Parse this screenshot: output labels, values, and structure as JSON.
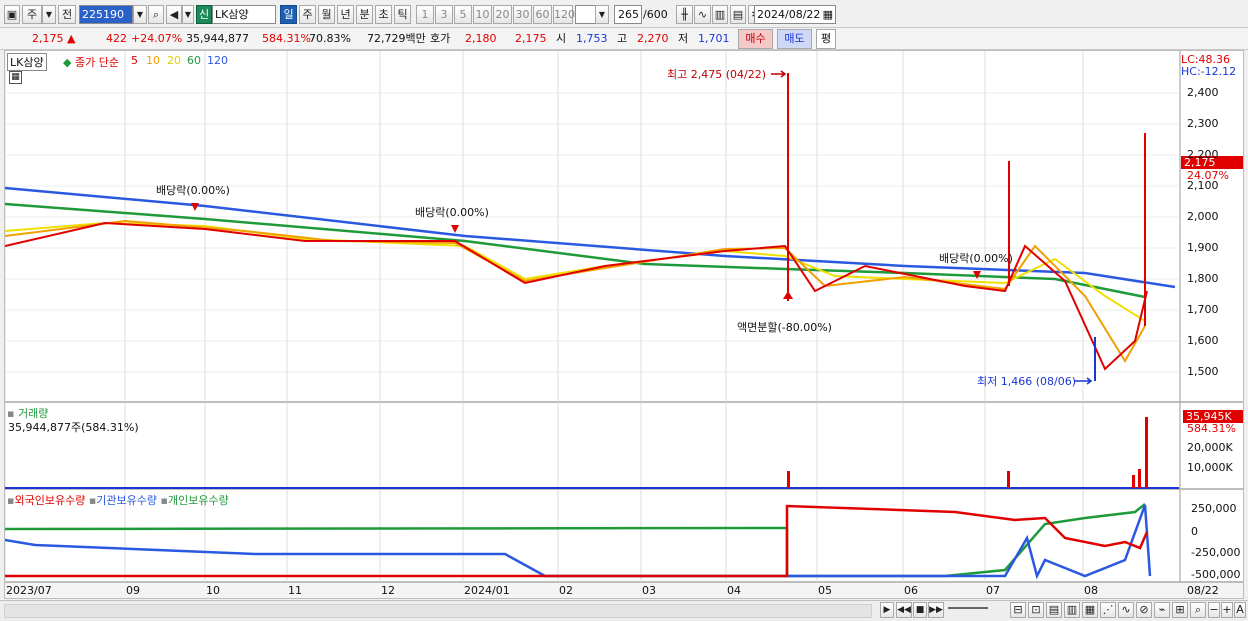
{
  "toolbar": {
    "period_label": "주",
    "prev_label": "전",
    "code": "225190",
    "sin_label": "신",
    "name": "LK삼양",
    "period_buttons": [
      "일",
      "주",
      "월",
      "년",
      "분",
      "초",
      "틱"
    ],
    "interval_buttons": [
      "1",
      "3",
      "5",
      "10",
      "20",
      "30",
      "60",
      "120"
    ],
    "count": "265",
    "count_total": "/600",
    "date": "2024/08/22"
  },
  "quote": {
    "price": "2,175",
    "change_arrow": "▲",
    "change": "422",
    "change_pct": "+24.07%",
    "volume": "35,944,877",
    "volume_ratio": "584.31%",
    "turnover": "70.83%",
    "amount": "72,729백만",
    "hoga_label": "호가",
    "ask": "2,180",
    "bid": "2,175",
    "open_label": "시",
    "open": "1,753",
    "high_label": "고",
    "high": "2,270",
    "low_label": "저",
    "low": "1,701",
    "buy_label": "매수",
    "sell_label": "매도",
    "avg_label": "평"
  },
  "price_panel": {
    "name_tag": "LK삼양",
    "ma_title": "종가 단순",
    "ma_periods": [
      "5",
      "10",
      "20",
      "60",
      "120"
    ],
    "ma_colors": [
      "#e00000",
      "#f0a000",
      "#f0e000",
      "#1f9a3a",
      "#2a59e0"
    ],
    "lc": "LC:48.36",
    "hc": "HC:-12.12",
    "price_axis": [
      "2,400",
      "2,300",
      "2,200",
      "2,100",
      "2,000",
      "1,900",
      "1,800",
      "1,700",
      "1,600",
      "1,500"
    ],
    "current_price_tag": "2,175",
    "current_pct_tag": "24.07%",
    "annotations": {
      "high": "최고 2,475 (04/22)",
      "low": "최저 1,466 (08/06)",
      "div1": "배당락(0.00%)",
      "div2": "배당락(0.00%)",
      "div3": "배당락(0.00%)",
      "split": "액면분할(-80.00%)"
    }
  },
  "volume_panel": {
    "title": "거래량",
    "value": "35,944,877주(584.31%)",
    "tag_value": "35,945K",
    "tag_pct": "584.31%",
    "axis": [
      "20,000K",
      "10,000K"
    ]
  },
  "holding_panel": {
    "series": [
      "외국인보유수량",
      "기관보유수량",
      "개인보유수량"
    ],
    "series_colors": [
      "#e00000",
      "#2a59e0",
      "#1f9a3a"
    ],
    "axis": [
      "250,000",
      "0",
      "-250,000",
      "-500,000"
    ]
  },
  "x_axis": {
    "labels": [
      "2023/07",
      "09",
      "10",
      "11",
      "12",
      "2024/01",
      "02",
      "03",
      "04",
      "05",
      "06",
      "07",
      "08"
    ],
    "end_label": "08/22"
  }
}
